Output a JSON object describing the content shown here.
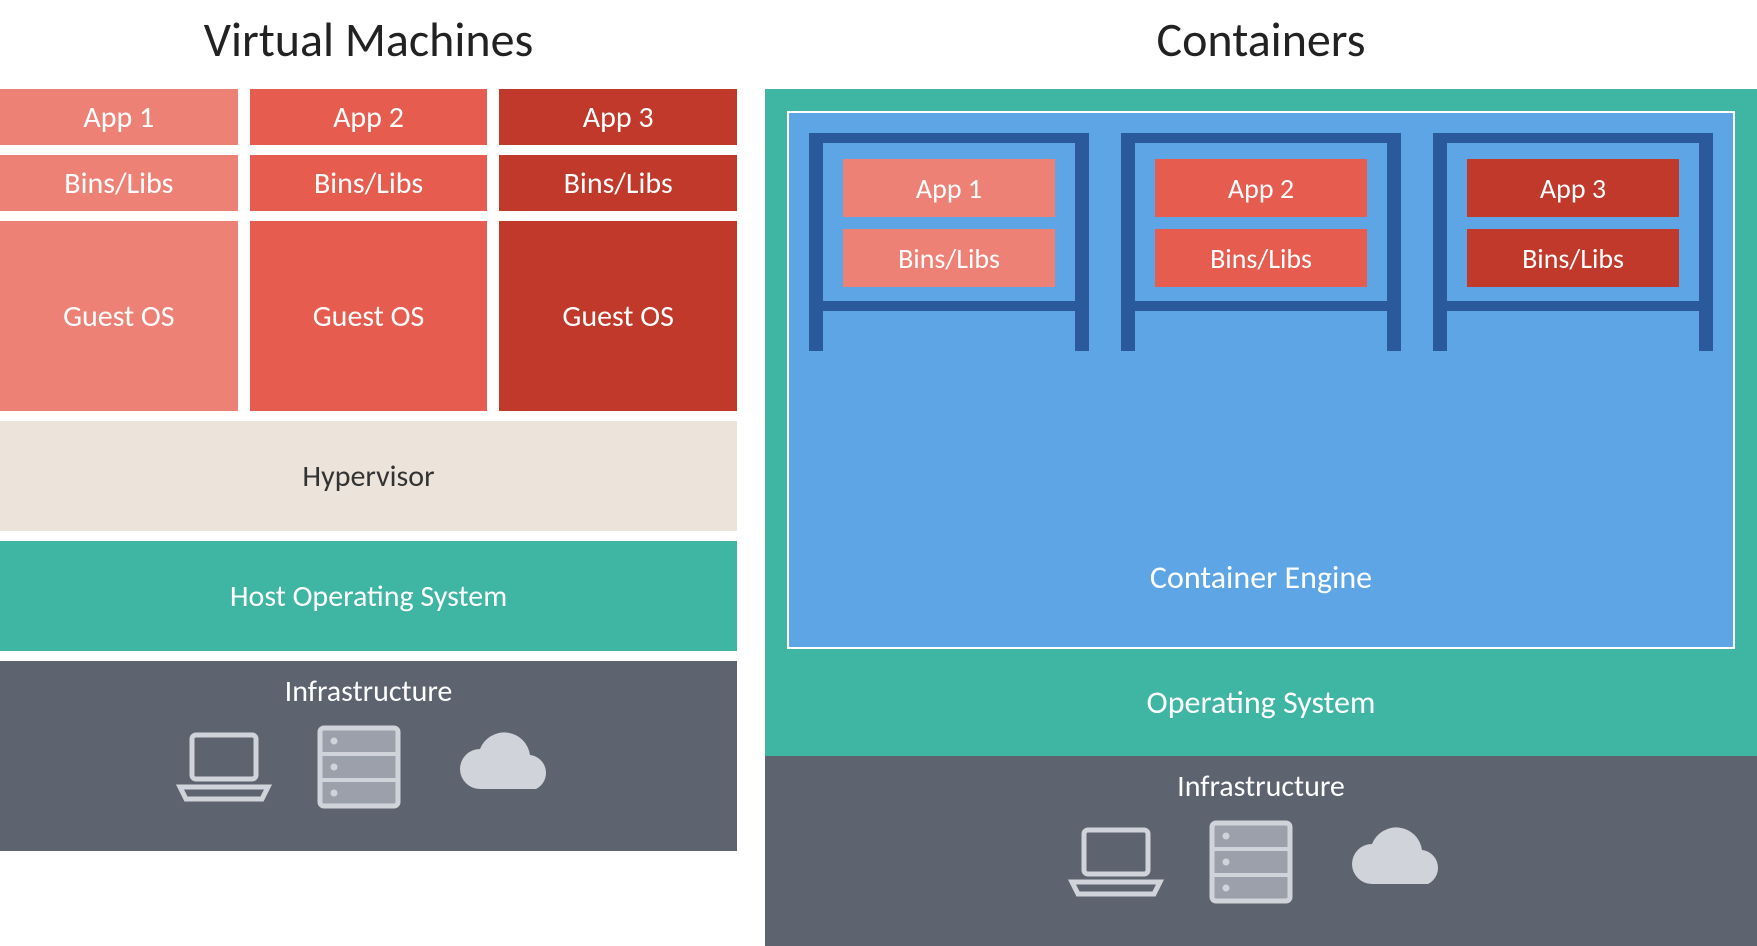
{
  "left": {
    "title": "Virtual Machines",
    "vms": [
      {
        "app": "App 1",
        "bins": "Bins/Libs",
        "guest": "Guest OS"
      },
      {
        "app": "App 2",
        "bins": "Bins/Libs",
        "guest": "Guest OS"
      },
      {
        "app": "App 3",
        "bins": "Bins/Libs",
        "guest": "Guest OS"
      }
    ],
    "hypervisor": "Hypervisor",
    "host_os": "Host Operating System",
    "infra": "Infrastructure"
  },
  "right": {
    "title": "Containers",
    "containers": [
      {
        "app": "App 1",
        "bins": "Bins/Libs"
      },
      {
        "app": "App 2",
        "bins": "Bins/Libs"
      },
      {
        "app": "App 3",
        "bins": "Bins/Libs"
      }
    ],
    "engine": "Container Engine",
    "os": "Operating System",
    "infra": "Infrastructure"
  },
  "colors": {
    "red1": "#ee8176",
    "red2": "#e65c4f",
    "red3": "#c0392b",
    "teal": "#3fb5a4",
    "blue": "#5ea5e6",
    "darkblue": "#2a5a9c",
    "beige": "#ece4db",
    "slate": "#5d636f"
  }
}
